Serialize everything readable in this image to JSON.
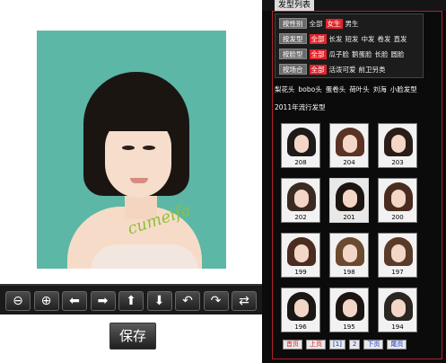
{
  "right_panel": {
    "tab_label": "发型列表",
    "filters": [
      {
        "key": "按性别",
        "options": [
          {
            "label": "全部",
            "active": false
          },
          {
            "label": "女生",
            "active": true
          },
          {
            "label": "男生",
            "active": false
          }
        ]
      },
      {
        "key": "按发型",
        "options": [
          {
            "label": "全部",
            "active": true
          },
          {
            "label": "长发",
            "active": false
          },
          {
            "label": "短发",
            "active": false
          },
          {
            "label": "中发",
            "active": false
          },
          {
            "label": "卷发",
            "active": false
          },
          {
            "label": "直发",
            "active": false
          }
        ]
      },
      {
        "key": "按脸型",
        "options": [
          {
            "label": "全部",
            "active": true
          },
          {
            "label": "瓜子脸",
            "active": false
          },
          {
            "label": "鹅蛋脸",
            "active": false
          },
          {
            "label": "长脸",
            "active": false
          },
          {
            "label": "圆脸",
            "active": false
          }
        ]
      },
      {
        "key": "按场合",
        "options": [
          {
            "label": "全部",
            "active": true
          },
          {
            "label": "活泼可爱",
            "active": false
          },
          {
            "label": "前卫另类",
            "active": false
          }
        ]
      }
    ],
    "tags_line1": [
      "梨花头",
      "bobo头",
      "蛋卷头",
      "荷叶头",
      "刘海",
      "小脸发型"
    ],
    "tags_line2": "2011年流行发型",
    "thumbnails": [
      "208",
      "204",
      "203",
      "202",
      "201",
      "200",
      "199",
      "198",
      "197",
      "196",
      "195",
      "194"
    ],
    "selected_thumbnail": "201",
    "pager": {
      "first": "首页",
      "prev": "上页",
      "page1": "[1]",
      "page2": "2",
      "next": "下页",
      "last": "尾页"
    }
  },
  "photo": {
    "signature_text": "cumeifa"
  },
  "toolbar": {
    "buttons": [
      {
        "icon": "zoom-out-icon",
        "glyph": "⊖"
      },
      {
        "icon": "zoom-in-icon",
        "glyph": "⊕"
      },
      {
        "icon": "arrow-left-icon",
        "glyph": "⬅"
      },
      {
        "icon": "arrow-right-icon",
        "glyph": "➡"
      },
      {
        "icon": "arrow-up-icon",
        "glyph": "⬆"
      },
      {
        "icon": "arrow-down-icon",
        "glyph": "⬇"
      },
      {
        "icon": "rotate-left-icon",
        "glyph": "↶"
      },
      {
        "icon": "rotate-right-icon",
        "glyph": "↷"
      },
      {
        "icon": "flip-icon",
        "glyph": "⇄"
      }
    ]
  },
  "save_label": "保存",
  "colors": {
    "accent_red": "#e0242c",
    "panel_bg": "#0b0b0b",
    "photo_bg": "#5db7a6",
    "frame_border": "#b1222a"
  }
}
